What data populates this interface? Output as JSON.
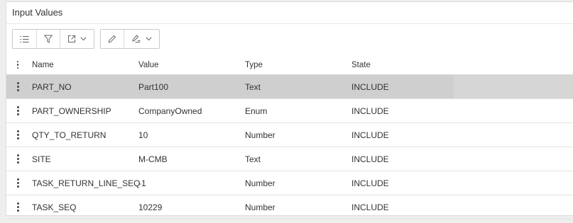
{
  "panel": {
    "title": "Input Values"
  },
  "toolbar": {
    "group1": [
      {
        "icon": "list-icon"
      },
      {
        "icon": "filter-icon"
      },
      {
        "icon": "export-icon",
        "dropdown": true
      }
    ],
    "group2": [
      {
        "icon": "pencil-icon"
      },
      {
        "icon": "bulk-edit-icon",
        "dropdown": true
      }
    ]
  },
  "table": {
    "columns": [
      "Name",
      "Value",
      "Type",
      "State"
    ],
    "rows": [
      {
        "name": "PART_NO",
        "value": "Part100",
        "type": "Text",
        "state": "INCLUDE",
        "selected": true
      },
      {
        "name": "PART_OWNERSHIP",
        "value": "CompanyOwned",
        "type": "Enum",
        "state": "INCLUDE"
      },
      {
        "name": "QTY_TO_RETURN",
        "value": "10",
        "type": "Number",
        "state": "INCLUDE"
      },
      {
        "name": "SITE",
        "value": "M-CMB",
        "type": "Text",
        "state": "INCLUDE"
      },
      {
        "name": "TASK_RETURN_LINE_SEQ",
        "value": "-1",
        "type": "Number",
        "state": "INCLUDE"
      },
      {
        "name": "TASK_SEQ",
        "value": "10229",
        "type": "Number",
        "state": "INCLUDE"
      }
    ]
  }
}
